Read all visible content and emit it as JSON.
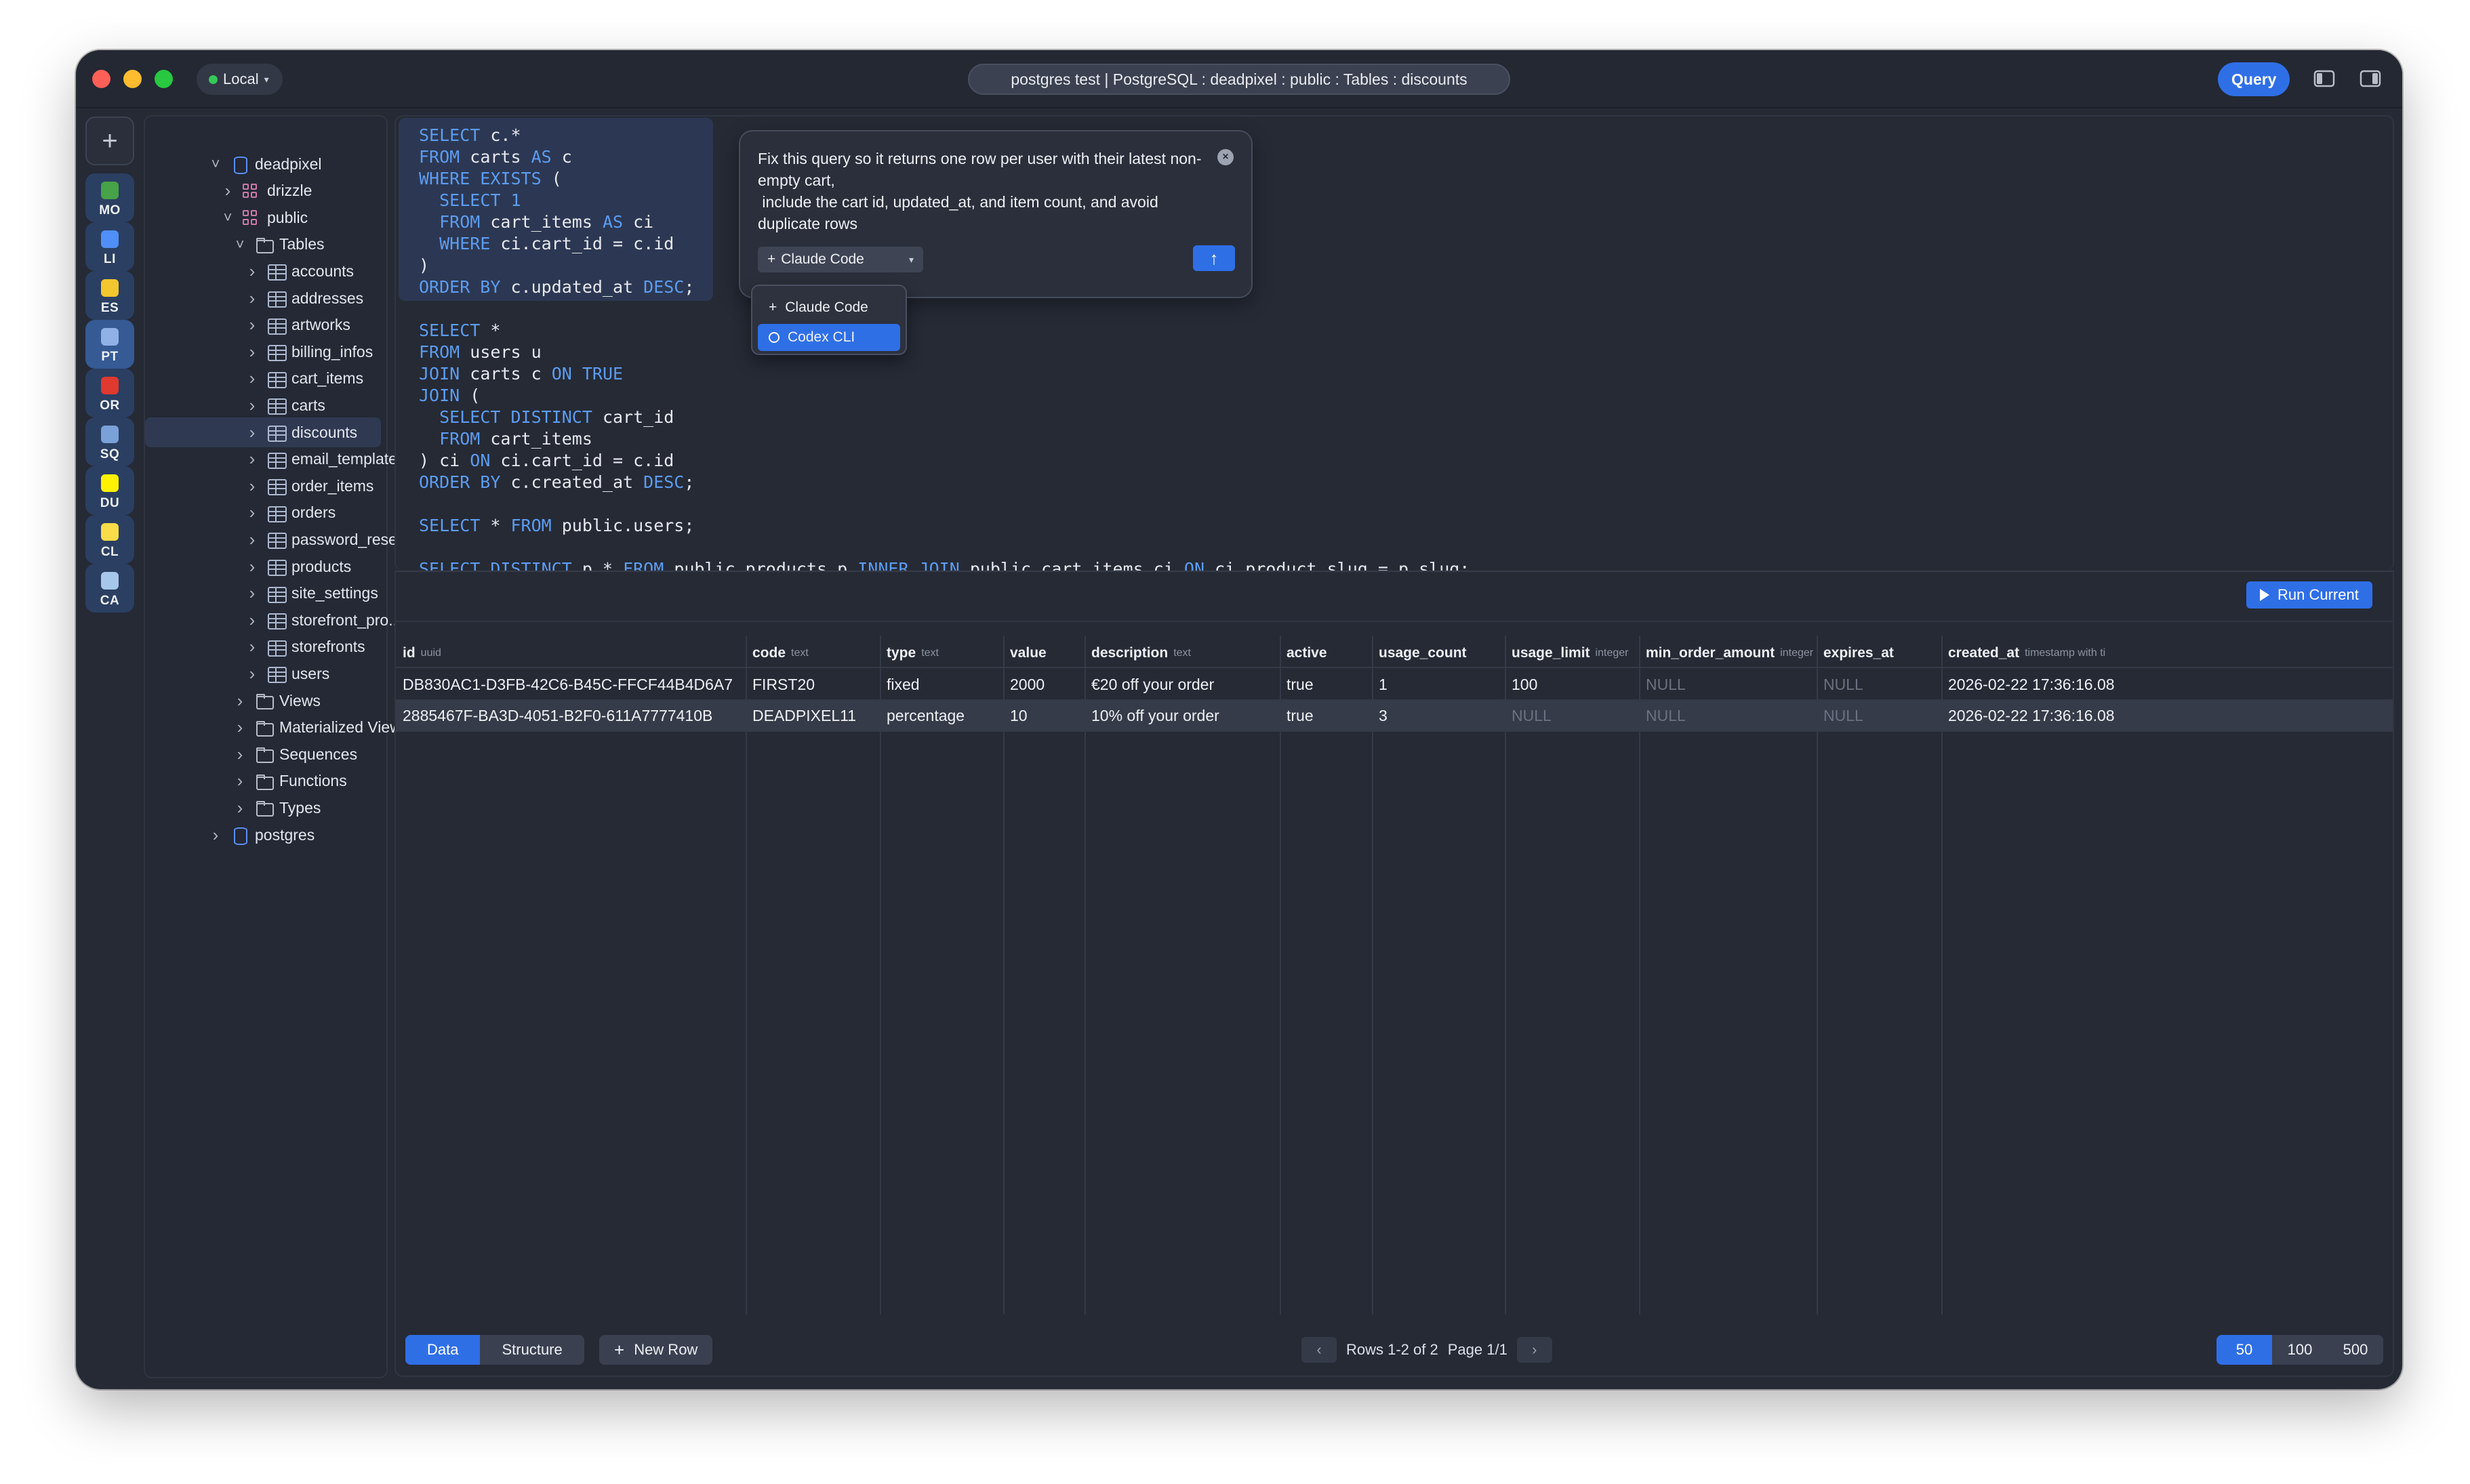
{
  "titlebar": {
    "environment": "Local",
    "title": "postgres test | PostgreSQL : deadpixel : public : Tables : discounts",
    "query_button": "Query"
  },
  "connections": [
    {
      "abbr": "MO",
      "icon": "mongodb-icon",
      "color": "#47a248"
    },
    {
      "abbr": "LI",
      "icon": "libsql-icon",
      "color": "#4f8ff7"
    },
    {
      "abbr": "ES",
      "icon": "elasticsearch-icon",
      "color": "#f2c62f"
    },
    {
      "abbr": "PT",
      "icon": "postgresql-icon",
      "color": "#8fb1e6"
    },
    {
      "abbr": "OR",
      "icon": "oracle-icon",
      "color": "#e0392f"
    },
    {
      "abbr": "SQ",
      "icon": "sqlite-icon",
      "color": "#7aa2d8"
    },
    {
      "abbr": "DU",
      "icon": "duckdb-icon",
      "color": "#fff100"
    },
    {
      "abbr": "CL",
      "icon": "clickhouse-icon",
      "color": "#fadb48"
    },
    {
      "abbr": "CA",
      "icon": "cassandra-icon",
      "color": "#a7c7ea"
    }
  ],
  "tree": {
    "database": "deadpixel",
    "schemas": [
      "drizzle",
      "public"
    ],
    "tables_folder": "Tables",
    "tables": [
      "accounts",
      "addresses",
      "artworks",
      "billing_infos",
      "cart_items",
      "carts",
      "discounts",
      "email_templates",
      "order_items",
      "orders",
      "password_rese...",
      "products",
      "site_settings",
      "storefront_pro...",
      "storefronts",
      "users"
    ],
    "selected_table": "discounts",
    "folders": [
      "Views",
      "Materialized Views",
      "Sequences",
      "Functions",
      "Types"
    ],
    "other_database": "postgres"
  },
  "editor": {
    "lines": [
      [
        {
          "k": 1,
          "t": "SELECT"
        },
        {
          "t": " c.*"
        }
      ],
      [
        {
          "k": 1,
          "t": "FROM"
        },
        {
          "t": " carts "
        },
        {
          "k": 1,
          "t": "AS"
        },
        {
          "t": " c"
        }
      ],
      [
        {
          "k": 1,
          "t": "WHERE EXISTS"
        },
        {
          "t": " ("
        }
      ],
      [
        {
          "t": "  "
        },
        {
          "k": 1,
          "t": "SELECT 1"
        }
      ],
      [
        {
          "t": "  "
        },
        {
          "k": 1,
          "t": "FROM"
        },
        {
          "t": " cart_items "
        },
        {
          "k": 1,
          "t": "AS"
        },
        {
          "t": " ci"
        }
      ],
      [
        {
          "t": "  "
        },
        {
          "k": 1,
          "t": "WHERE"
        },
        {
          "t": " ci.cart_id = c.id"
        }
      ],
      [
        {
          "t": ")"
        }
      ],
      [
        {
          "k": 1,
          "t": "ORDER BY"
        },
        {
          "t": " c.updated_at "
        },
        {
          "k": 1,
          "t": "DESC"
        },
        {
          "t": ";"
        }
      ],
      [],
      [
        {
          "k": 1,
          "t": "SELECT"
        },
        {
          "t": " *"
        }
      ],
      [
        {
          "k": 1,
          "t": "FROM"
        },
        {
          "t": " users u"
        }
      ],
      [
        {
          "k": 1,
          "t": "JOIN"
        },
        {
          "t": " carts c "
        },
        {
          "k": 1,
          "t": "ON TRUE"
        }
      ],
      [
        {
          "k": 1,
          "t": "JOIN"
        },
        {
          "t": " ("
        }
      ],
      [
        {
          "t": "  "
        },
        {
          "k": 1,
          "t": "SELECT DISTINCT"
        },
        {
          "t": " cart_id"
        }
      ],
      [
        {
          "t": "  "
        },
        {
          "k": 1,
          "t": "FROM"
        },
        {
          "t": " cart_items"
        }
      ],
      [
        {
          "t": ") ci "
        },
        {
          "k": 1,
          "t": "ON"
        },
        {
          "t": " ci.cart_id = c.id"
        }
      ],
      [
        {
          "k": 1,
          "t": "ORDER BY"
        },
        {
          "t": " c.created_at "
        },
        {
          "k": 1,
          "t": "DESC"
        },
        {
          "t": ";"
        }
      ],
      [],
      [
        {
          "k": 1,
          "t": "SELECT"
        },
        {
          "t": " * "
        },
        {
          "k": 1,
          "t": "FROM"
        },
        {
          "t": " public.users;"
        }
      ],
      [],
      [
        {
          "k": 1,
          "t": "SELECT DISTINCT"
        },
        {
          "t": " p.* "
        },
        {
          "k": 1,
          "t": "FROM"
        },
        {
          "t": " public.products p "
        },
        {
          "k": 1,
          "t": "INNER JOIN"
        },
        {
          "t": " public.cart_items ci "
        },
        {
          "k": 1,
          "t": "ON"
        },
        {
          "t": " ci.product_slug = p.slug;"
        }
      ]
    ],
    "run_button": "Run Current"
  },
  "ai": {
    "prompt": "Fix this query so it returns one row per user with their latest non-empty cart,\n include the cart id, updated_at, and item count, and avoid duplicate rows",
    "agent": "Claude Code",
    "agent_options": [
      "Claude Code",
      "Codex CLI"
    ],
    "highlighted_option": "Codex CLI"
  },
  "grid": {
    "columns": [
      {
        "name": "id",
        "type": "uuid"
      },
      {
        "name": "code",
        "type": "text"
      },
      {
        "name": "type",
        "type": "text"
      },
      {
        "name": "value",
        "type": ""
      },
      {
        "name": "description",
        "type": "text"
      },
      {
        "name": "active",
        "type": ""
      },
      {
        "name": "usage_count",
        "type": ""
      },
      {
        "name": "usage_limit",
        "type": "integer"
      },
      {
        "name": "min_order_amount",
        "type": "integer"
      },
      {
        "name": "expires_at",
        "type": ""
      },
      {
        "name": "created_at",
        "type": "timestamp with ti"
      }
    ],
    "rows": [
      [
        "DB830AC1-D3FB-42C6-B45C-FFCF44B4D6A7",
        "FIRST20",
        "fixed",
        "2000",
        "€20 off your order",
        "true",
        "1",
        "100",
        "NULL",
        "NULL",
        "2026-02-22 17:36:16.08"
      ],
      [
        "2885467F-BA3D-4051-B2F0-611A7777410B",
        "DEADPIXEL11",
        "percentage",
        "10",
        "10% off your order",
        "true",
        "3",
        "NULL",
        "NULL",
        "NULL",
        "2026-02-22 17:36:16.08"
      ]
    ],
    "tabs": [
      "Data",
      "Structure"
    ],
    "active_tab": "Data",
    "new_row": "New Row",
    "rows_label": "Rows 1-2 of 2",
    "page_label": "Page 1/1",
    "page_sizes": [
      "50",
      "100",
      "500"
    ],
    "active_page_size": "50"
  }
}
